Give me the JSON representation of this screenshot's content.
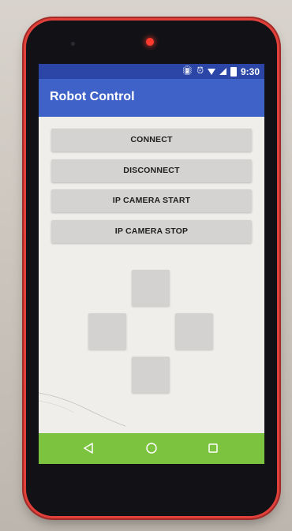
{
  "status_bar": {
    "time": "9:30",
    "icons": [
      "vibrate-icon",
      "alarm-icon",
      "wifi-icon",
      "signal-icon",
      "battery-icon"
    ]
  },
  "app_bar": {
    "title": "Robot Control",
    "color": "#3f62c9"
  },
  "buttons": {
    "connect": "CONNECT",
    "disconnect": "DISCONNECT",
    "ip_camera_start": "IP CAMERA START",
    "ip_camera_stop": "IP CAMERA STOP"
  },
  "dpad": {
    "buttons": [
      "up",
      "left",
      "right",
      "down"
    ]
  },
  "nav_bar": {
    "color": "#7cc440",
    "icons": [
      "back-icon",
      "home-icon",
      "recent-apps-icon"
    ]
  },
  "device": {
    "frame_color": "#e2413b"
  }
}
